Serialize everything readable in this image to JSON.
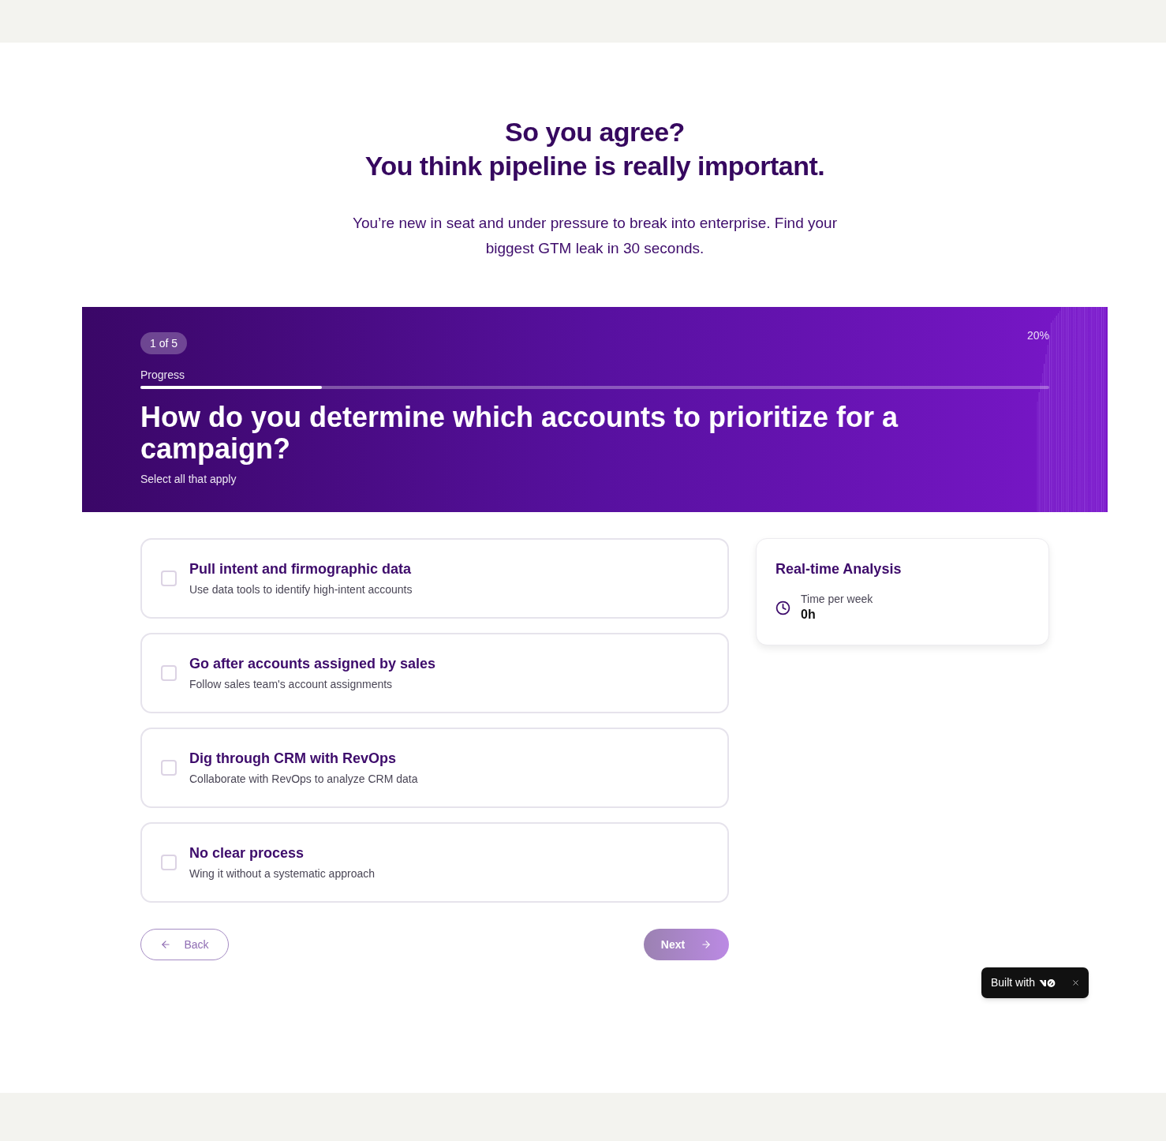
{
  "headline": [
    "So you agree?",
    "You think pipeline is really important."
  ],
  "subtitle": "You’re new in seat and under pressure to break into enterprise. Find your biggest GTM leak in 30 seconds.",
  "quiz": {
    "step_badge": "1 of 5",
    "progress": {
      "label": "Progress",
      "level": 0.2,
      "reading": "20%"
    },
    "question": "How do you determine which accounts to prioritize for a campaign?",
    "hint": "Select all that apply"
  },
  "options": [
    {
      "title": "Pull intent and firmographic data",
      "description": "Use data tools to identify high-intent accounts",
      "checked": false
    },
    {
      "title": "Go after accounts assigned by sales",
      "description": "Follow sales team's account assignments",
      "checked": false
    },
    {
      "title": "Dig through CRM with RevOps",
      "description": "Collaborate with RevOps to analyze CRM data",
      "checked": false
    },
    {
      "title": "No clear process",
      "description": "Wing it without a systematic approach",
      "checked": false
    }
  ],
  "analysis": {
    "title": "Real-time Analysis",
    "metric_label": "Time per week",
    "metric_value": "0h"
  },
  "navigation": {
    "back": {
      "label": "Back"
    },
    "next": {
      "label": "Next",
      "disabled": true
    }
  },
  "built_with_badge": {
    "label": "Built with"
  }
}
